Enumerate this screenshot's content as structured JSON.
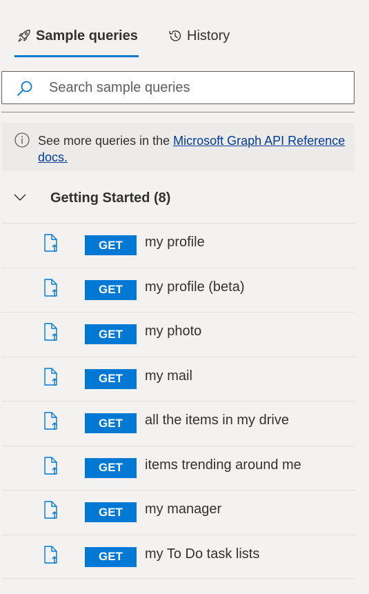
{
  "tabs": {
    "sample_label": "Sample queries",
    "history_label": "History"
  },
  "search": {
    "placeholder": "Search sample queries"
  },
  "info": {
    "prefix": "See more queries in the ",
    "link_text": "Microsoft Graph API Reference docs."
  },
  "group": {
    "title": "Getting Started",
    "count": "(8)"
  },
  "queries": [
    {
      "method": "GET",
      "label": "my profile"
    },
    {
      "method": "GET",
      "label": "my profile (beta)"
    },
    {
      "method": "GET",
      "label": "my photo"
    },
    {
      "method": "GET",
      "label": "my mail"
    },
    {
      "method": "GET",
      "label": "all the items in my drive"
    },
    {
      "method": "GET",
      "label": "items trending around me"
    },
    {
      "method": "GET",
      "label": "my manager"
    },
    {
      "method": "GET",
      "label": "my To Do task lists"
    }
  ],
  "colors": {
    "accent": "#0078d4",
    "link": "#003c96",
    "background": "#f3f2f1"
  }
}
